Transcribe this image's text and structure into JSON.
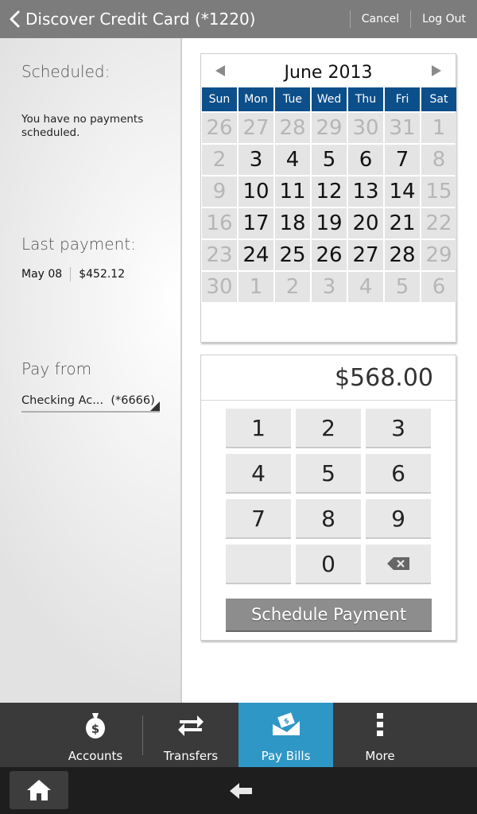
{
  "header": {
    "title": "Discover Credit Card (*1220)",
    "cancel_label": "Cancel",
    "logout_label": "Log Out"
  },
  "left": {
    "scheduled_label": "Scheduled:",
    "scheduled_text": "You have no payments scheduled.",
    "last_payment_label": "Last payment:",
    "last_payment_date": "May 08",
    "last_payment_amount": "$452.12",
    "pay_from_label": "Pay from",
    "pay_from_value": "Checking Ac...  (*6666)"
  },
  "calendar": {
    "title": "June 2013",
    "days_of_week": [
      "Sun",
      "Mon",
      "Tue",
      "Wed",
      "Thu",
      "Fri",
      "Sat"
    ],
    "weeks": [
      [
        "26",
        "27",
        "28",
        "29",
        "30",
        "31",
        "1"
      ],
      [
        "2",
        "3",
        "4",
        "5",
        "6",
        "7",
        "8"
      ],
      [
        "9",
        "10",
        "11",
        "12",
        "13",
        "14",
        "15"
      ],
      [
        "16",
        "17",
        "18",
        "19",
        "20",
        "21",
        "22"
      ],
      [
        "23",
        "24",
        "25",
        "26",
        "27",
        "28",
        "29"
      ],
      [
        "30",
        "1",
        "2",
        "3",
        "4",
        "5",
        "6"
      ]
    ],
    "muted": [
      [
        true,
        true,
        true,
        true,
        true,
        true,
        true
      ],
      [
        true,
        false,
        false,
        false,
        false,
        false,
        true
      ],
      [
        true,
        false,
        false,
        false,
        false,
        false,
        true
      ],
      [
        true,
        false,
        false,
        false,
        false,
        false,
        true
      ],
      [
        true,
        false,
        false,
        false,
        false,
        false,
        true
      ],
      [
        true,
        true,
        true,
        true,
        true,
        true,
        true
      ]
    ]
  },
  "keypad": {
    "amount": "$568.00",
    "keys": [
      "1",
      "2",
      "3",
      "4",
      "5",
      "6",
      "7",
      "8",
      "9",
      "",
      "0",
      "backspace"
    ],
    "schedule_label": "Schedule Payment"
  },
  "tabs": [
    {
      "label": "Accounts",
      "icon": "money-bag-icon",
      "active": false
    },
    {
      "label": "Transfers",
      "icon": "transfer-arrows-icon",
      "active": false
    },
    {
      "label": "Pay Bills",
      "icon": "pay-bill-envelope-icon",
      "active": true
    },
    {
      "label": "More",
      "icon": "more-dots-icon",
      "active": false
    }
  ],
  "colors": {
    "header_bg": "#7c7c7c",
    "calendar_dow_bg": "#0d4f8a",
    "active_tab_bg": "#2f97c6",
    "tabbar_bg": "#3a3a3a"
  }
}
